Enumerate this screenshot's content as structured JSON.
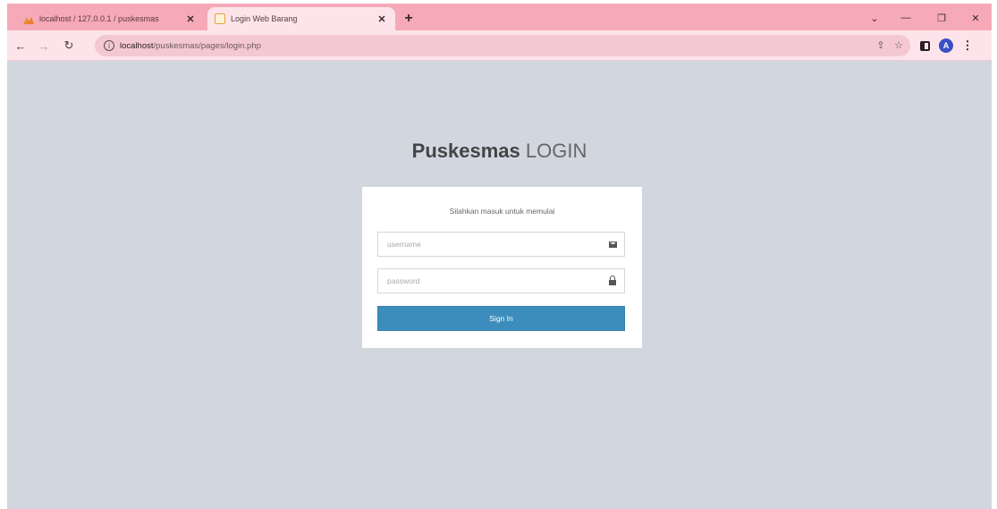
{
  "browser": {
    "tabs": [
      {
        "title": "localhost / 127.0.0.1 / puskesmas",
        "active": false
      },
      {
        "title": "Login Web Barang",
        "active": true
      }
    ],
    "tab_close_glyph": "✕",
    "new_tab_glyph": "+",
    "window_controls": {
      "minimize": "—",
      "restore": "❐",
      "close": "✕",
      "tab_search": "⌄"
    },
    "url": {
      "host": "localhost",
      "path": "/puskesmas/pages/login.php"
    },
    "profile_initial": "A"
  },
  "page": {
    "logo": {
      "bold": "Puskesmas",
      "light": "LOGIN"
    },
    "login_message": "Silahkan masuk untuk memulai",
    "username": {
      "placeholder": "username",
      "value": ""
    },
    "password": {
      "placeholder": "password",
      "value": ""
    },
    "signin_label": "Sign In"
  },
  "colors": {
    "tabstrip": "#f6a9b8",
    "toolbar": "#fde4ea",
    "page_background": "#d2d6de",
    "primary_button": "#3c8dbc"
  }
}
